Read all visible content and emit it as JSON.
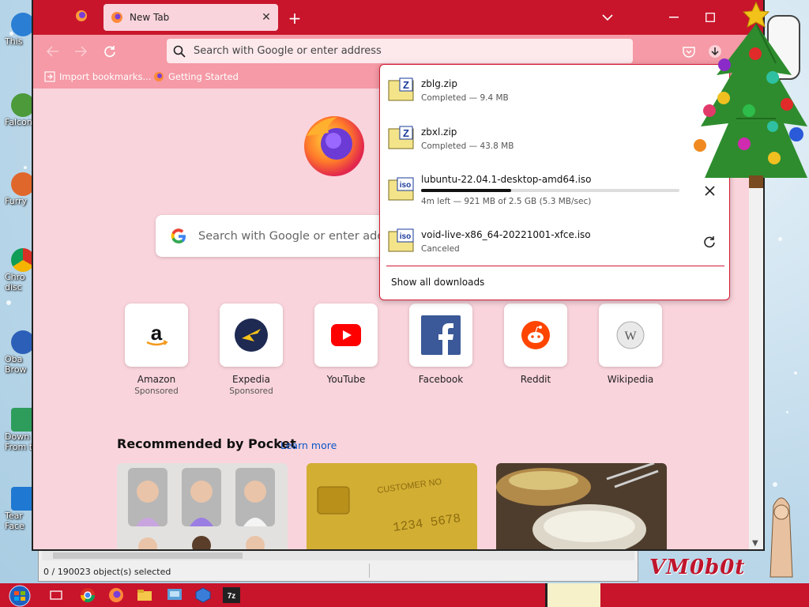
{
  "desktop": {
    "icons": [
      {
        "label": "This",
        "color": "#2a7fd4"
      },
      {
        "label": "Falcon",
        "color": "#4c9a3a"
      },
      {
        "label": "Furry",
        "color": "#e0672c"
      },
      {
        "label": "Chro",
        "label2": "disc",
        "color": "#d93025"
      },
      {
        "label": "Oba",
        "label2": "Brow",
        "color": "#2c5fb8"
      },
      {
        "label": "Down",
        "label2": "From t",
        "color": "#2e9d5b"
      },
      {
        "label": "Tear",
        "label2": "Face",
        "color": "#1f78d1"
      }
    ],
    "watermark": "VM0b0t"
  },
  "explorer": {
    "status": "0 / 190023 object(s) selected"
  },
  "browser": {
    "tab_title": "New Tab",
    "url_placeholder": "Search with Google or enter address",
    "bookmarks": [
      {
        "label": "Import bookmarks...",
        "icon": "import-icon"
      },
      {
        "label": "Getting Started",
        "icon": "firefox-icon"
      }
    ],
    "search_placeholder": "Search with Google or enter address",
    "top_sites": [
      {
        "name": "Amazon",
        "sponsored": "Sponsored"
      },
      {
        "name": "Expedia",
        "sponsored": "Sponsored"
      },
      {
        "name": "YouTube",
        "sponsored": ""
      },
      {
        "name": "Facebook",
        "sponsored": ""
      },
      {
        "name": "Reddit",
        "sponsored": ""
      },
      {
        "name": "Wikipedia",
        "sponsored": ""
      }
    ],
    "pocket": {
      "title": "Recommended by Pocket",
      "learn_more": "Learn more"
    }
  },
  "downloads": {
    "items": [
      {
        "name": "zblg.zip",
        "status": "Completed — 9.4 MB",
        "type": "zip"
      },
      {
        "name": "zbxl.zip",
        "status": "Completed — 43.8 MB",
        "type": "zip"
      },
      {
        "name": "lubuntu-22.04.1-desktop-amd64.iso",
        "status": "4m left — 921 MB of 2.5 GB (5.3 MB/sec)",
        "type": "iso",
        "progress": 0.35
      },
      {
        "name": "void-live-x86_64-20221001-xfce.iso",
        "status": "Canceled",
        "type": "iso"
      }
    ],
    "show_all": "Show all downloads"
  },
  "colors": {
    "accent": "#c8152b",
    "toolbar": "#f59aa6",
    "page": "#fad4dc"
  }
}
